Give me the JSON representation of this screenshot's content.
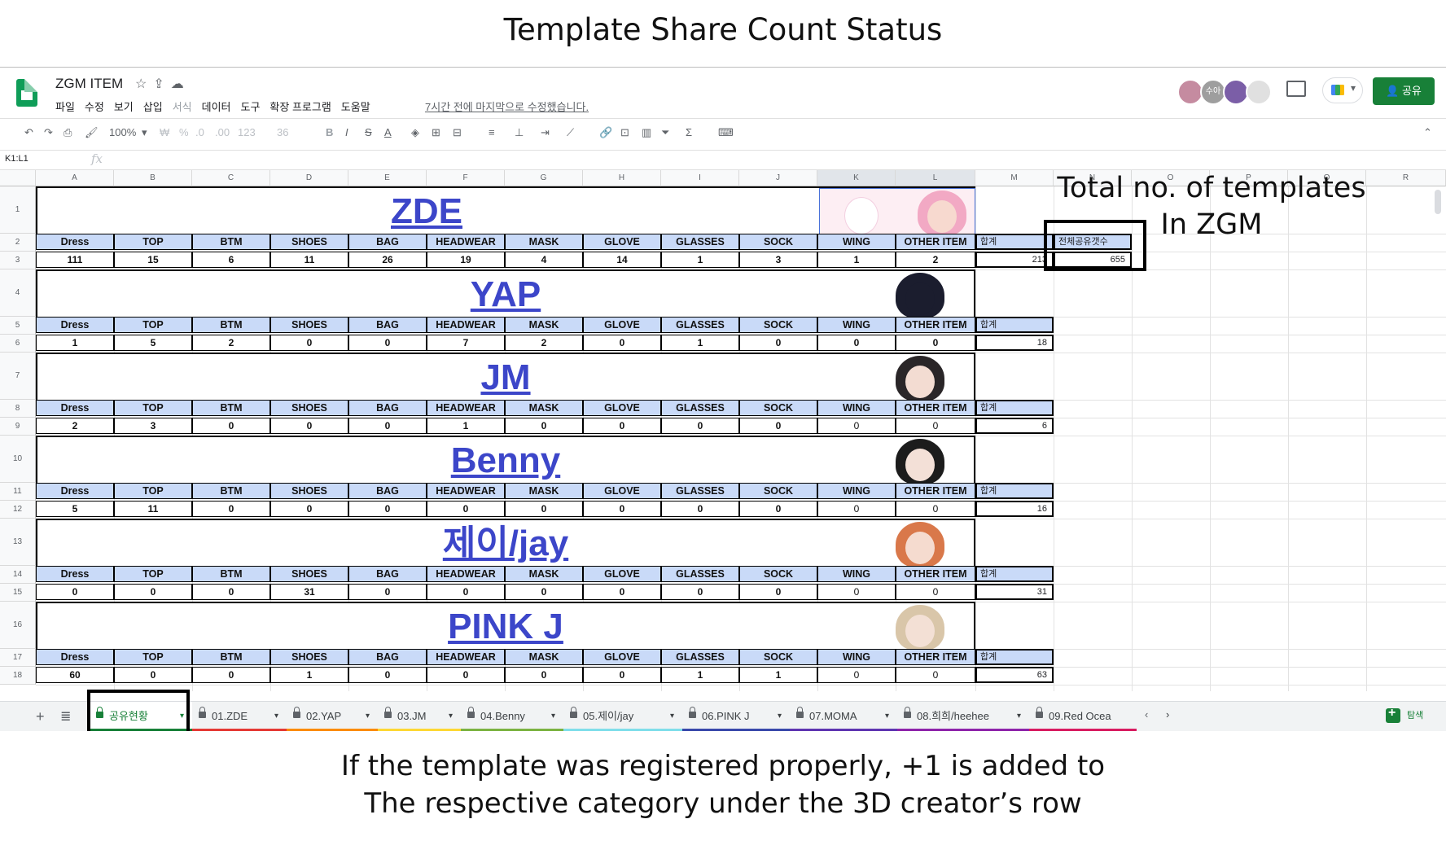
{
  "page_title": "Template Share Count Status",
  "app": {
    "file_name": "ZGM ITEM",
    "menu": [
      "파일",
      "수정",
      "보기",
      "삽입",
      "서식",
      "데이터",
      "도구",
      "확장 프로그램",
      "도움말"
    ],
    "last_edit": "7시간 전에 마지막으로 수정했습니다.",
    "share_label": "공유",
    "avatars": [
      {
        "label": "",
        "color": "#c58ba0"
      },
      {
        "label": "수아",
        "color": "#9e9e9e"
      },
      {
        "label": "",
        "color": "#7b5ea7"
      },
      {
        "label": "",
        "color": "#e0e0e0"
      }
    ]
  },
  "toolbar": {
    "zoom": "100%",
    "currency": "₩",
    "percent": "%",
    "decimal_dec": ".0",
    "decimal_inc": ".00",
    "number_format": "123",
    "font_size": "36",
    "bold": "B",
    "italic": "I",
    "strike": "S",
    "text_color": "A"
  },
  "formula_bar": {
    "name_box": "K1:L1",
    "fx": "fx"
  },
  "columns": [
    "A",
    "B",
    "C",
    "D",
    "E",
    "F",
    "G",
    "H",
    "I",
    "J",
    "K",
    "L",
    "M",
    "N",
    "O",
    "P",
    "Q",
    "R"
  ],
  "rows": [
    "1",
    "2",
    "3",
    "4",
    "5",
    "6",
    "7",
    "8",
    "9",
    "10",
    "11",
    "12",
    "13",
    "14",
    "15",
    "16",
    "17",
    "18"
  ],
  "categories": [
    "Dress",
    "TOP",
    "BTM",
    "SHOES",
    "BAG",
    "HEADWEAR",
    "MASK",
    "GLOVE",
    "GLASSES",
    "SOCK",
    "WING",
    "OTHER ITEM"
  ],
  "sum_label": "합계",
  "total_label": "전체공유갯수",
  "total_value": "655",
  "creators": [
    {
      "name": "ZDE",
      "values": [
        "111",
        "15",
        "6",
        "11",
        "26",
        "19",
        "4",
        "14",
        "1",
        "3",
        "1",
        "2"
      ],
      "sum": "213"
    },
    {
      "name": "YAP",
      "values": [
        "1",
        "5",
        "2",
        "0",
        "0",
        "7",
        "2",
        "0",
        "1",
        "0",
        "0",
        "0"
      ],
      "sum": "18"
    },
    {
      "name": "JM",
      "values": [
        "2",
        "3",
        "0",
        "0",
        "0",
        "1",
        "0",
        "0",
        "0",
        "0",
        "0",
        "0"
      ],
      "sum": "6"
    },
    {
      "name": "Benny",
      "values": [
        "5",
        "11",
        "0",
        "0",
        "0",
        "0",
        "0",
        "0",
        "0",
        "0",
        "0",
        "0"
      ],
      "sum": "16"
    },
    {
      "name": "제이/jay",
      "values": [
        "0",
        "0",
        "0",
        "31",
        "0",
        "0",
        "0",
        "0",
        "0",
        "0",
        "0",
        "0"
      ],
      "sum": "31"
    },
    {
      "name": "PINK J",
      "values": [
        "60",
        "0",
        "0",
        "1",
        "0",
        "0",
        "0",
        "0",
        "1",
        "1",
        "0",
        "0"
      ],
      "sum": "63"
    }
  ],
  "annotations": {
    "total_note_line1": "Total no. of templates",
    "total_note_line2": "In ZGM",
    "bottom_line1": "If the template was registered properly, +1 is added to",
    "bottom_line2": "The respective category under the 3D creator’s row"
  },
  "tabs": [
    {
      "label": "공유현황",
      "color": "#188038"
    },
    {
      "label": "01.ZDE",
      "color": "#e53935"
    },
    {
      "label": "02.YAP",
      "color": "#fb8c00"
    },
    {
      "label": "03.JM",
      "color": "#fdd835"
    },
    {
      "label": "04.Benny",
      "color": "#7cb342"
    },
    {
      "label": "05.제이/jay",
      "color": "#80deea"
    },
    {
      "label": "06.PINK J",
      "color": "#3949ab"
    },
    {
      "label": "07.MOMA",
      "color": "#5e35b1"
    },
    {
      "label": "08.희희/heehee",
      "color": "#8e24aa"
    },
    {
      "label": "09.Red Ocea",
      "color": "#d81b60"
    }
  ],
  "explore_label": "탐색",
  "colors": {
    "accent": "#188038",
    "header_fill": "#c9daf8",
    "title_blue": "#3c46c9"
  }
}
